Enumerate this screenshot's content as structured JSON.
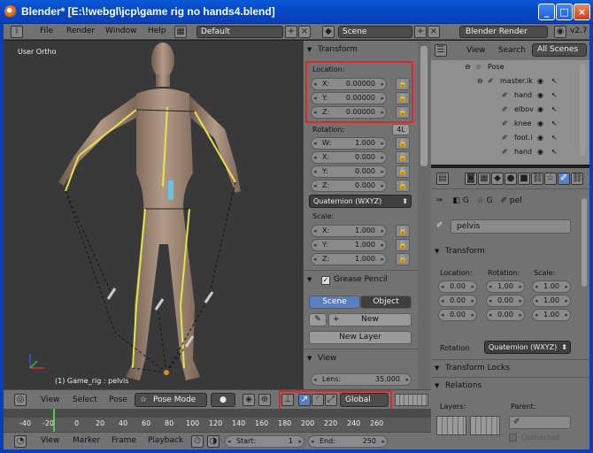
{
  "window": {
    "title": "Blender* [E:\\!webgl\\jcp\\game rig no hands4.blend]",
    "controls": [
      "_",
      "□",
      "×"
    ]
  },
  "info_header": {
    "menus": [
      "File",
      "Render",
      "Window",
      "Help"
    ],
    "layout": "Default",
    "scene": "Scene",
    "engine": "Blender Render",
    "version": "v2.7"
  },
  "viewport": {
    "view_label": "User Ortho",
    "object_label": "(1) Game_rig : pelvis"
  },
  "transform_panel": {
    "title": "Transform",
    "location_label": "Location:",
    "location": [
      {
        "k": "X:",
        "v": "0.00000"
      },
      {
        "k": "Y:",
        "v": "0.00000"
      },
      {
        "k": "Z:",
        "v": "0.00000"
      }
    ],
    "rotation_label": "Rotation:",
    "rotation_badge": "4L",
    "rotation": [
      {
        "k": "W:",
        "v": "1.000"
      },
      {
        "k": "X:",
        "v": "0.000"
      },
      {
        "k": "Y:",
        "v": "0.000"
      },
      {
        "k": "Z:",
        "v": "0.000"
      }
    ],
    "rotation_mode": "Quaternion (WXYZ)",
    "scale_label": "Scale:",
    "scale": [
      {
        "k": "X:",
        "v": "1.000"
      },
      {
        "k": "Y:",
        "v": "1.000"
      },
      {
        "k": "Z:",
        "v": "1.000"
      }
    ]
  },
  "grease_pencil": {
    "title": "Grease Pencil",
    "tab_scene": "Scene",
    "tab_object": "Object",
    "new_label": "New",
    "new_layer_label": "New Layer"
  },
  "view_panel": {
    "title": "View",
    "lens_label": "Lens:",
    "lens_value": "35.000"
  },
  "outliner": {
    "tabs": [
      "View",
      "Search",
      "All Scenes"
    ],
    "rows": [
      "Pose",
      "master.ik",
      "hand",
      "elbov",
      "knee",
      "foot.i",
      "hand"
    ]
  },
  "bone_props": {
    "breadcrumb": [
      "G",
      "G",
      "pel"
    ],
    "bone_name": "pelvis",
    "transform_title": "Transform",
    "location_label": "Location:",
    "rotation_label": "Rotation:",
    "scale_label": "Scale:",
    "location": [
      "0.00",
      "0.00",
      "0.00"
    ],
    "rotation": [
      "1.00",
      "0.00",
      "0.00"
    ],
    "scale": [
      "1.00",
      "1.00",
      "1.00"
    ],
    "rotation_mode_label": "Rotation",
    "rotation_mode": "Quaternion (WXYZ)",
    "transform_locks_title": "Transform Locks",
    "relations_title": "Relations",
    "layers_label": "Layers:",
    "parent_label": "Parent:",
    "connected_label": "Connected"
  },
  "header3d": {
    "menus": [
      "View",
      "Select",
      "Pose"
    ],
    "mode": "Pose Mode",
    "orientation": "Global"
  },
  "timeline": {
    "frames": [
      "-40",
      "-20",
      "0",
      "20",
      "40",
      "60",
      "80",
      "100",
      "120",
      "140",
      "160",
      "180",
      "200",
      "220",
      "240",
      "260"
    ],
    "menus": [
      "View",
      "Marker",
      "Frame",
      "Playback"
    ],
    "start_label": "Start:",
    "start_value": "1",
    "end_label": "End:",
    "end_value": "250"
  },
  "colors": {
    "highlight": "#e0282c",
    "active_tab": "#5680c2",
    "title_bar": "#0a5ad8"
  }
}
